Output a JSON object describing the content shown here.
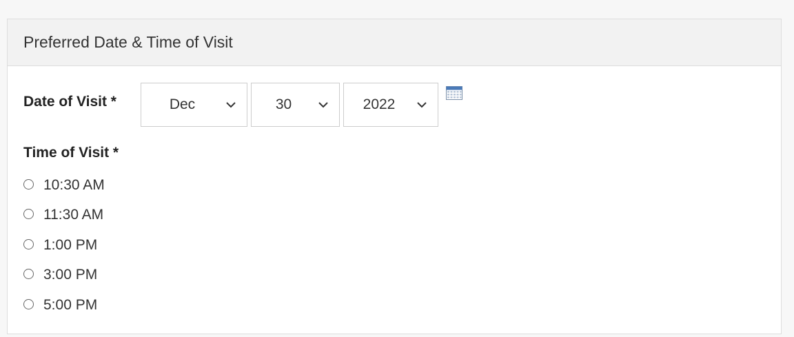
{
  "panel": {
    "title": "Preferred Date & Time of Visit"
  },
  "date": {
    "label": "Date of Visit *",
    "month": "Dec",
    "day": "30",
    "year": "2022",
    "calendar_icon": "calendar-icon"
  },
  "time": {
    "label": "Time of Visit *",
    "options": [
      {
        "label": "10:30 AM",
        "selected": false
      },
      {
        "label": "11:30 AM",
        "selected": false
      },
      {
        "label": "1:00 PM",
        "selected": false
      },
      {
        "label": "3:00 PM",
        "selected": false
      },
      {
        "label": "5:00 PM",
        "selected": false
      }
    ]
  },
  "colors": {
    "header_bg": "#f2f2f2",
    "border": "#dddddd",
    "calendar_accent": "#4a7ab8"
  }
}
